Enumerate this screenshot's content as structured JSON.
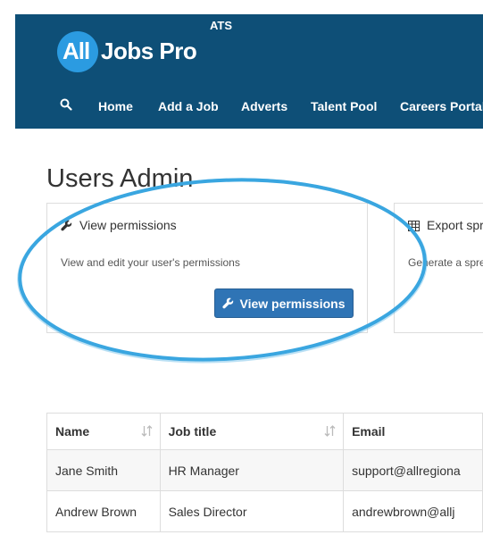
{
  "header": {
    "logo_all": "All",
    "logo_rest": "Jobs Pro",
    "badge": "ATS",
    "nav": {
      "search_icon": "search-icon",
      "items": [
        "Home",
        "Add a Job",
        "Adverts",
        "Talent Pool",
        "Careers Portal"
      ]
    }
  },
  "page": {
    "title": "Users Admin"
  },
  "cards": [
    {
      "icon": "wrench-icon",
      "heading": "View permissions",
      "description": "View and edit your user's permissions",
      "button_label": "View permissions"
    },
    {
      "icon": "table-icon",
      "heading": "Export spre",
      "description": "Generate a spre"
    }
  ],
  "table": {
    "columns": [
      "Name",
      "Job title",
      "Email"
    ],
    "rows": [
      [
        "Jane Smith",
        "HR Manager",
        "support@allregiona"
      ],
      [
        "Andrew Brown",
        "Sales Director",
        "andrewbrown@allj"
      ]
    ]
  },
  "colors": {
    "header_bg": "#0e4f77",
    "logo_circle": "#2b9be1",
    "button_bg": "#2f74b5",
    "highlight_ellipse": "#3aa6e0"
  }
}
